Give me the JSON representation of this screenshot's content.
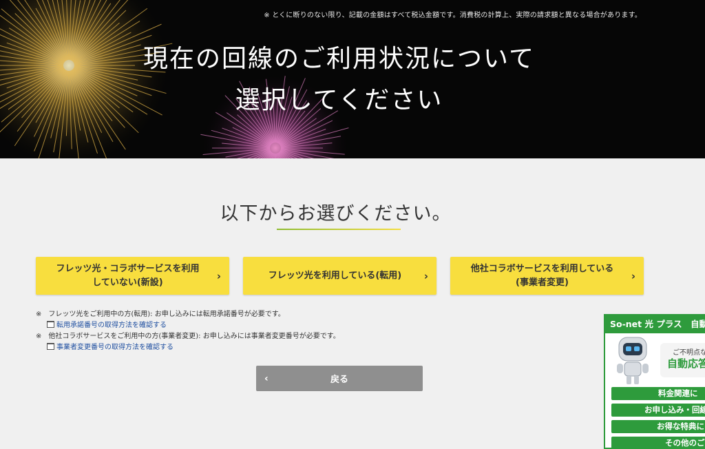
{
  "hero": {
    "notice": "※ とくに断りのない限り、記載の金額はすべて税込金額です。消費税の計算上、実際の請求額と異なる場合があります。",
    "title_line1": "現在の回線のご利用状況について",
    "title_line2": "選択してください"
  },
  "section": {
    "heading": "以下からお選びください。"
  },
  "options": [
    {
      "label_line1": "フレッツ光・コラボサービスを利用",
      "label_line2": "していない(新設)"
    },
    {
      "label_line1": "フレッツ光を利用している(転用)",
      "label_line2": ""
    },
    {
      "label_line1": "他社コラボサービスを利用している",
      "label_line2": "(事業者変更)"
    }
  ],
  "notes": {
    "note1": "※　フレッツ光をご利用中の方(転用): お申し込みには転用承諾番号が必要です。",
    "link1": "転用承諾番号の取得方法を確認する",
    "note2": "※　他社コラボサービスをご利用中の方(事業者変更): お申し込みには事業者変更番号が必要です。",
    "link2": "事業者変更番号の取得方法を確認する"
  },
  "back_button": {
    "label": "戻る"
  },
  "widget": {
    "header": "So-net 光 プラス　自動",
    "bubble_small": "ご不明点な",
    "bubble_big": "自動応答",
    "buttons": [
      "料金関連に",
      "お申し込み・回線",
      "お得な特典に",
      "その他のご"
    ]
  },
  "colors": {
    "accent_yellow": "#f8de3e",
    "widget_green": "#2e9b3c",
    "back_gray": "#8f8f8f",
    "link_blue": "#1f4fa0"
  },
  "icons": {
    "option_chevron": "chevron-right-icon",
    "back_chevron": "chevron-left-icon",
    "note_link": "document-icon",
    "widget_mascot": "robot-icon"
  }
}
